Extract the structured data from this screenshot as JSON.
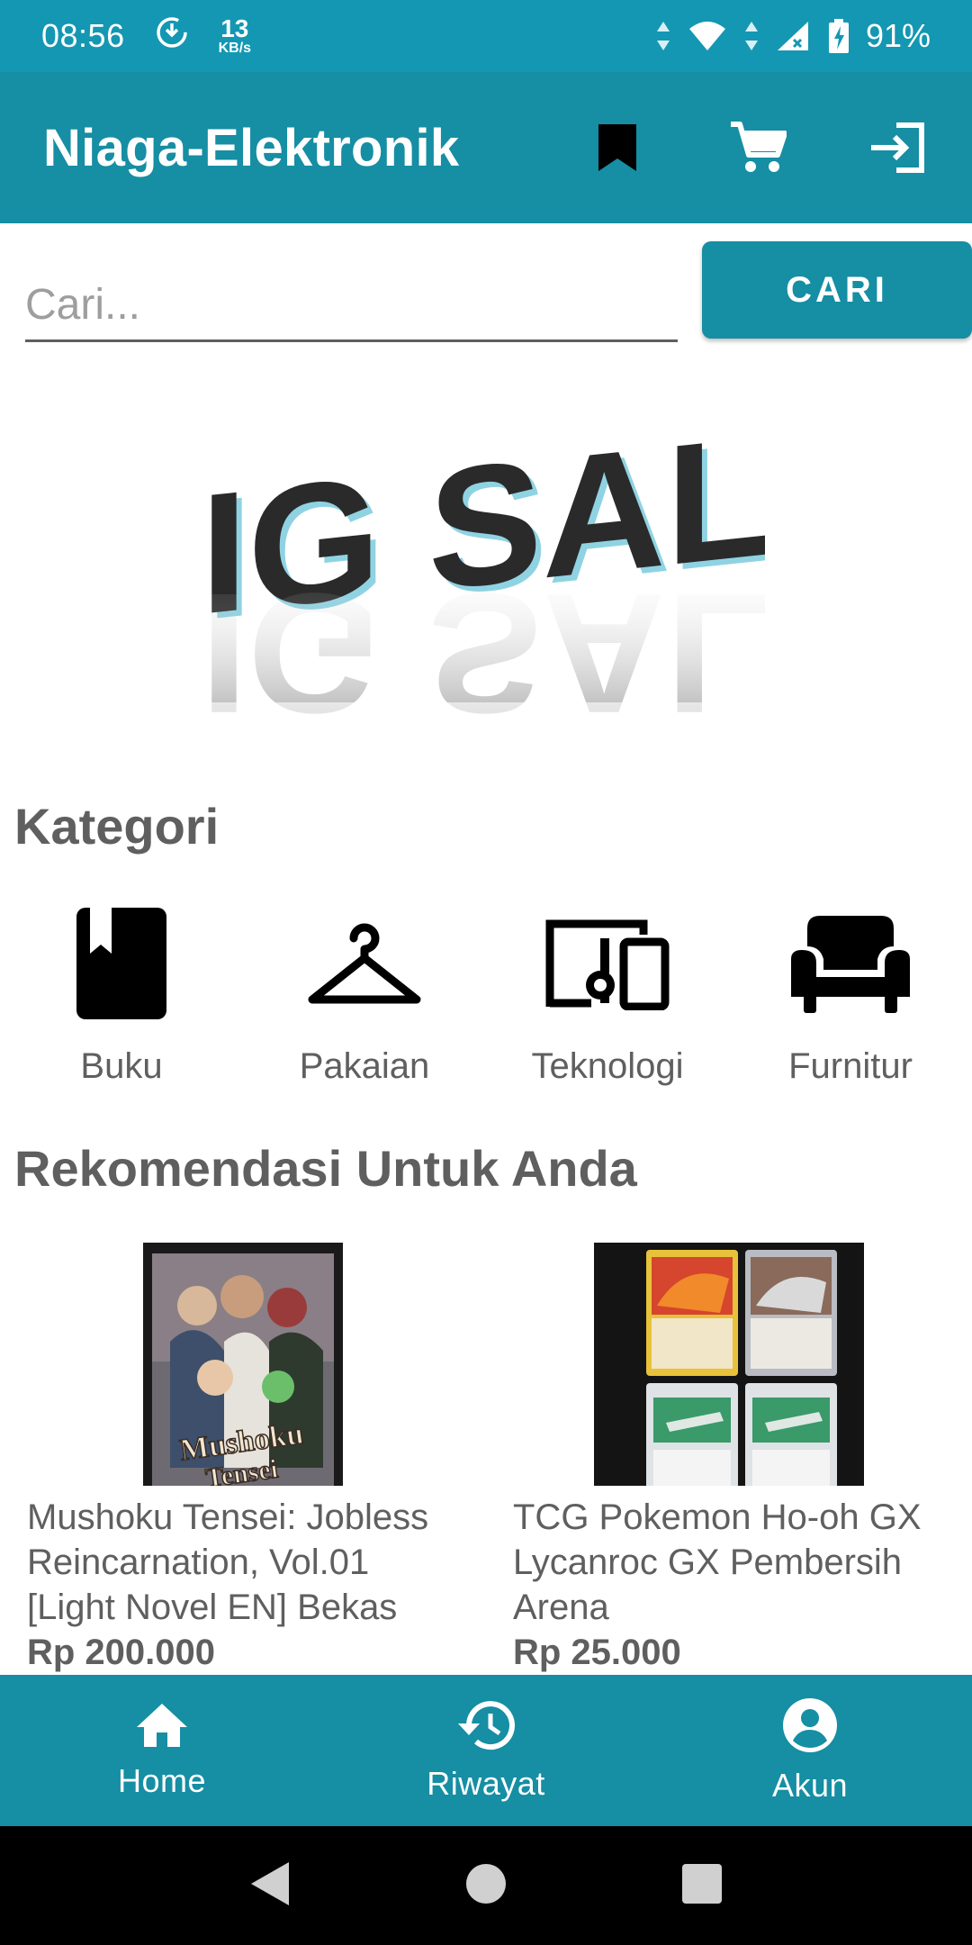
{
  "status_bar": {
    "time": "08:56",
    "net_speed_value": "13",
    "net_speed_unit": "KB/s",
    "battery": "91%"
  },
  "app_bar": {
    "title": "Niaga-Elektronik",
    "icons": [
      "bookmark-icon",
      "cart-icon",
      "login-icon"
    ]
  },
  "search": {
    "placeholder": "Cari...",
    "value": "",
    "button_label": "CARI"
  },
  "banner": {
    "text": "BIG SALE"
  },
  "categories": {
    "title": "Kategori",
    "items": [
      {
        "label": "Buku",
        "icon": "book-icon"
      },
      {
        "label": "Pakaian",
        "icon": "hanger-icon"
      },
      {
        "label": "Teknologi",
        "icon": "devices-icon"
      },
      {
        "label": "Furnitur",
        "icon": "sofa-icon"
      }
    ]
  },
  "recommendations": {
    "title": "Rekomendasi Untuk Anda",
    "items": [
      {
        "name": "Mushoku Tensei: Jobless Reincarnation, Vol.01 [Light Novel EN] Bekas",
        "price": "Rp 200.000",
        "image_text": "Mushoku Tensei"
      },
      {
        "name": "TCG Pokemon Ho-oh GX Lycanroc GX Pembersih Arena",
        "price": "Rp 25.000"
      }
    ]
  },
  "bottom_nav": {
    "items": [
      {
        "label": "Home",
        "icon": "home-icon"
      },
      {
        "label": "Riwayat",
        "icon": "history-icon"
      },
      {
        "label": "Akun",
        "icon": "account-icon"
      }
    ]
  },
  "colors": {
    "primary": "#168ea3",
    "status_bar": "#1497b3",
    "text": "#5f5f5f"
  }
}
